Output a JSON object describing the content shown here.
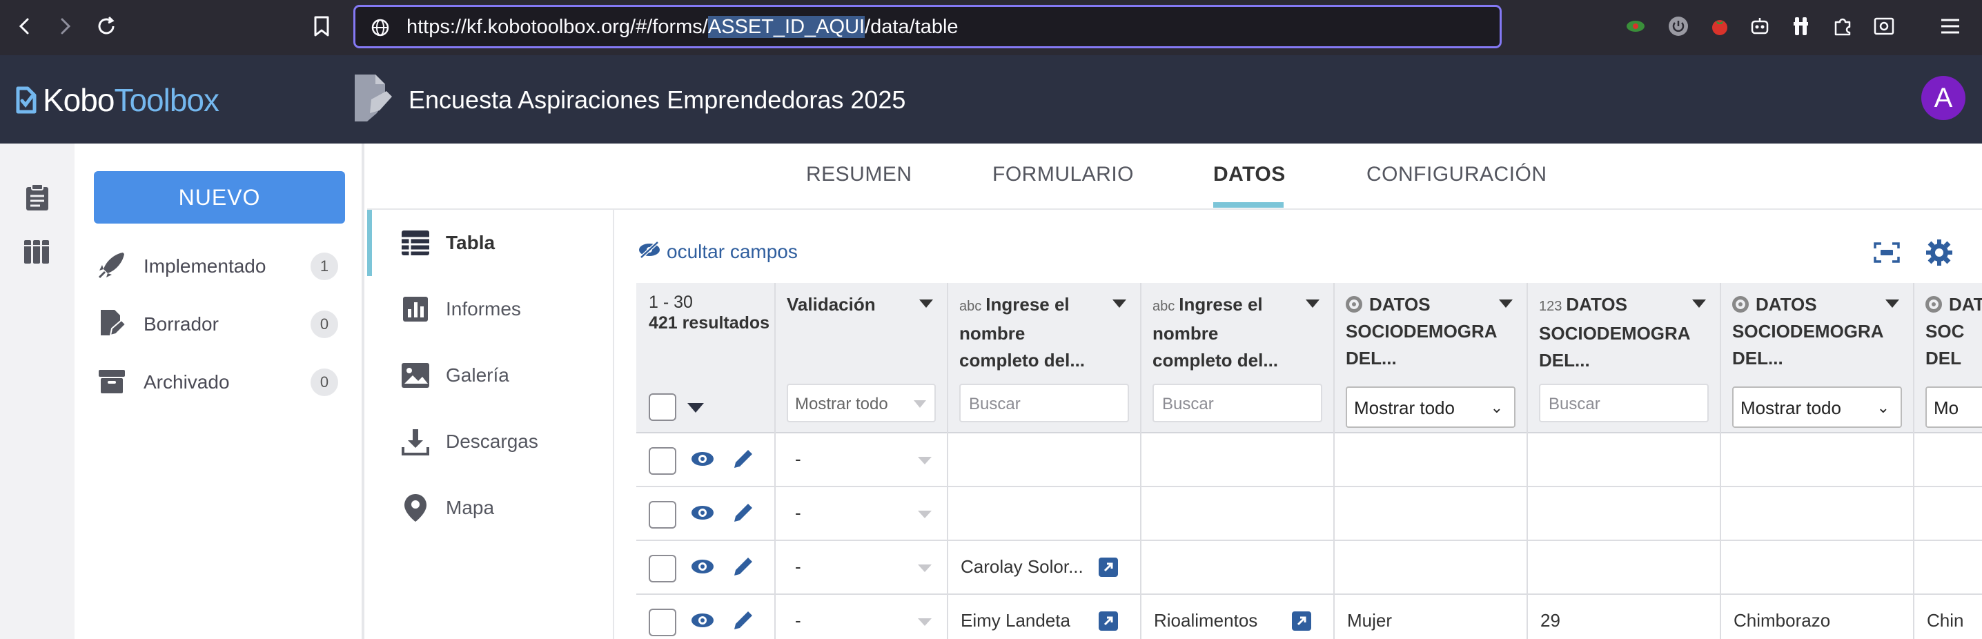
{
  "browser": {
    "url_prefix": "https://kf.kobotoolbox.org/#/forms/",
    "url_selected": "ASSET_ID_AQUI",
    "url_suffix": "/data/table"
  },
  "header": {
    "logo_part1": "Kobo",
    "logo_part2": "Toolbox",
    "project_title": "Encuesta Aspiraciones Emprendedoras 2025",
    "avatar_initial": "A"
  },
  "sidebar": {
    "new_button": "NUEVO",
    "items": [
      {
        "label": "Implementado",
        "count": "1"
      },
      {
        "label": "Borrador",
        "count": "0"
      },
      {
        "label": "Archivado",
        "count": "0"
      }
    ]
  },
  "tabs": [
    {
      "label": "RESUMEN"
    },
    {
      "label": "FORMULARIO"
    },
    {
      "label": "DATOS",
      "active": true
    },
    {
      "label": "CONFIGURACIÓN"
    }
  ],
  "subnav": [
    {
      "label": "Tabla",
      "icon": "table-icon",
      "active": true
    },
    {
      "label": "Informes",
      "icon": "bar-chart-icon"
    },
    {
      "label": "Galería",
      "icon": "image-icon"
    },
    {
      "label": "Descargas",
      "icon": "download-icon"
    },
    {
      "label": "Mapa",
      "icon": "map-pin-icon"
    }
  ],
  "toolbar": {
    "hide_fields": "ocultar campos"
  },
  "table": {
    "range": "1 - 30",
    "results": "421 resultados",
    "columns": [
      {
        "title": "Validación",
        "type": "",
        "filter": "Mostrar todo"
      },
      {
        "title_lines": [
          "Ingrese el",
          "nombre",
          "completo del..."
        ],
        "type": "abc",
        "filter_placeholder": "Buscar"
      },
      {
        "title_lines": [
          "Ingrese el",
          "nombre",
          "completo del..."
        ],
        "type": "abc",
        "filter_placeholder": "Buscar"
      },
      {
        "title_lines": [
          "DATOS",
          "SOCIODEMOGRA",
          "DEL..."
        ],
        "type": "radio",
        "filter": "Mostrar todo"
      },
      {
        "title_lines": [
          "DATOS",
          "SOCIODEMOGRA",
          "DEL..."
        ],
        "type": "123",
        "filter_placeholder": "Buscar"
      },
      {
        "title_lines": [
          "DATOS",
          "SOCIODEMOGRA",
          "DEL..."
        ],
        "type": "radio",
        "filter": "Mostrar todo"
      },
      {
        "title_lines": [
          "DATOS",
          "SOC",
          "DEL"
        ],
        "type": "radio",
        "filter": "Mo"
      }
    ],
    "rows": [
      {
        "validation": "-",
        "name1": "",
        "name2": "",
        "c3": "",
        "c4": "",
        "c5": "",
        "c6": ""
      },
      {
        "validation": "-",
        "name1": "",
        "name2": "",
        "c3": "",
        "c4": "",
        "c5": "",
        "c6": ""
      },
      {
        "validation": "-",
        "name1": "Carolay Solor...",
        "name2": "",
        "c3": "",
        "c4": "",
        "c5": "",
        "c6": ""
      },
      {
        "validation": "-",
        "name1": "Eimy Landeta",
        "name2": "Rioalimentos",
        "c3": "Mujer",
        "c4": "29",
        "c5": "Chimborazo",
        "c6": "Chin"
      }
    ]
  }
}
